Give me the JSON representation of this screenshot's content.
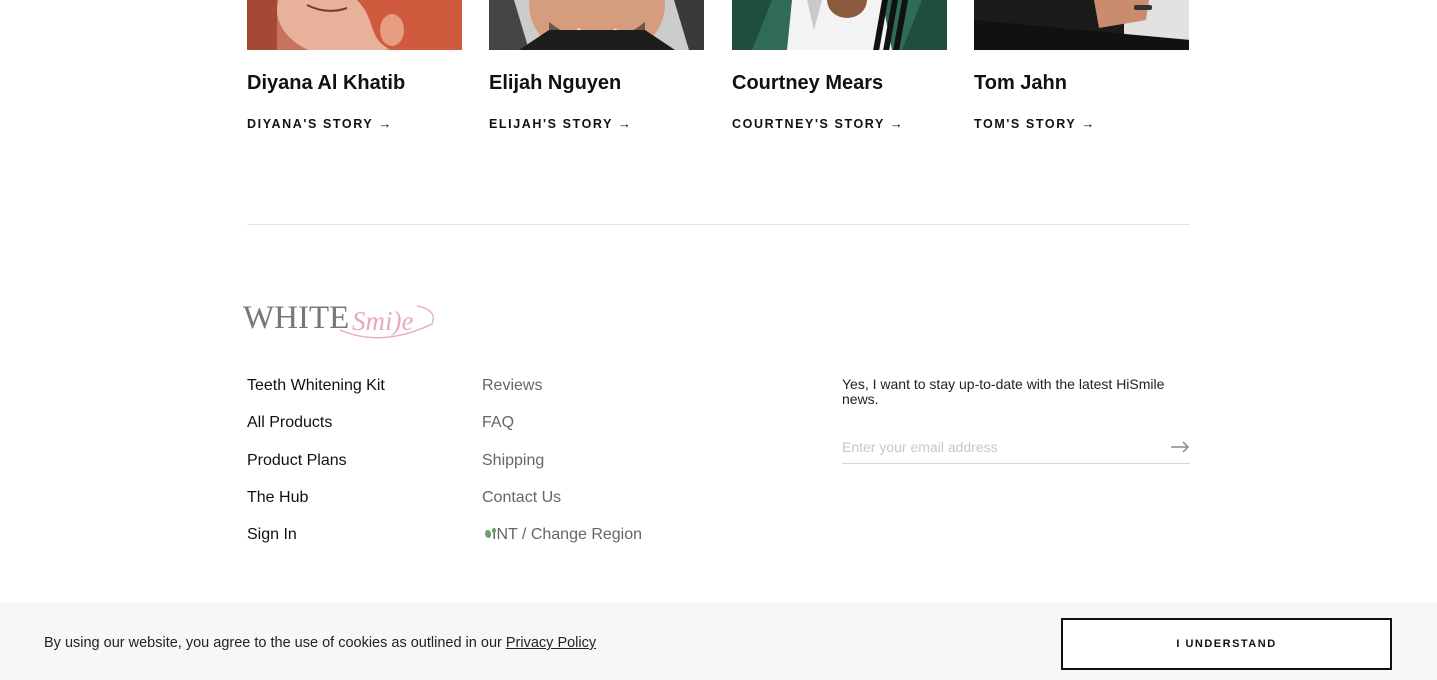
{
  "stories": [
    {
      "name": "Diyana Al Khatib",
      "link": "DIYANA'S STORY"
    },
    {
      "name": "Elijah Nguyen",
      "link": "ELIJAH'S STORY"
    },
    {
      "name": "Courtney Mears",
      "link": "COURTNEY'S STORY"
    },
    {
      "name": "Tom Jahn",
      "link": "TOM'S STORY"
    }
  ],
  "arrow": "→",
  "logo": {
    "part1": "WHITE",
    "part2": "Smi)e"
  },
  "footer": {
    "col_a": [
      "Teeth Whitening Kit",
      "All Products",
      "Product Plans",
      "The Hub",
      "Sign In"
    ],
    "col_b": [
      "Reviews",
      "FAQ",
      "Shipping",
      "Contact Us"
    ],
    "region": "INT / Change Region"
  },
  "newsletter": {
    "text": "Yes, I want to stay up-to-date with the latest HiSmile news.",
    "placeholder": "Enter your email address"
  },
  "cookie": {
    "text": "By using our website, you agree to the use of cookies as outlined in our ",
    "link": "Privacy Policy",
    "button": "I UNDERSTAND"
  },
  "colors": {
    "logo_gray": "#777777",
    "logo_pink": "#e8a8c4"
  }
}
